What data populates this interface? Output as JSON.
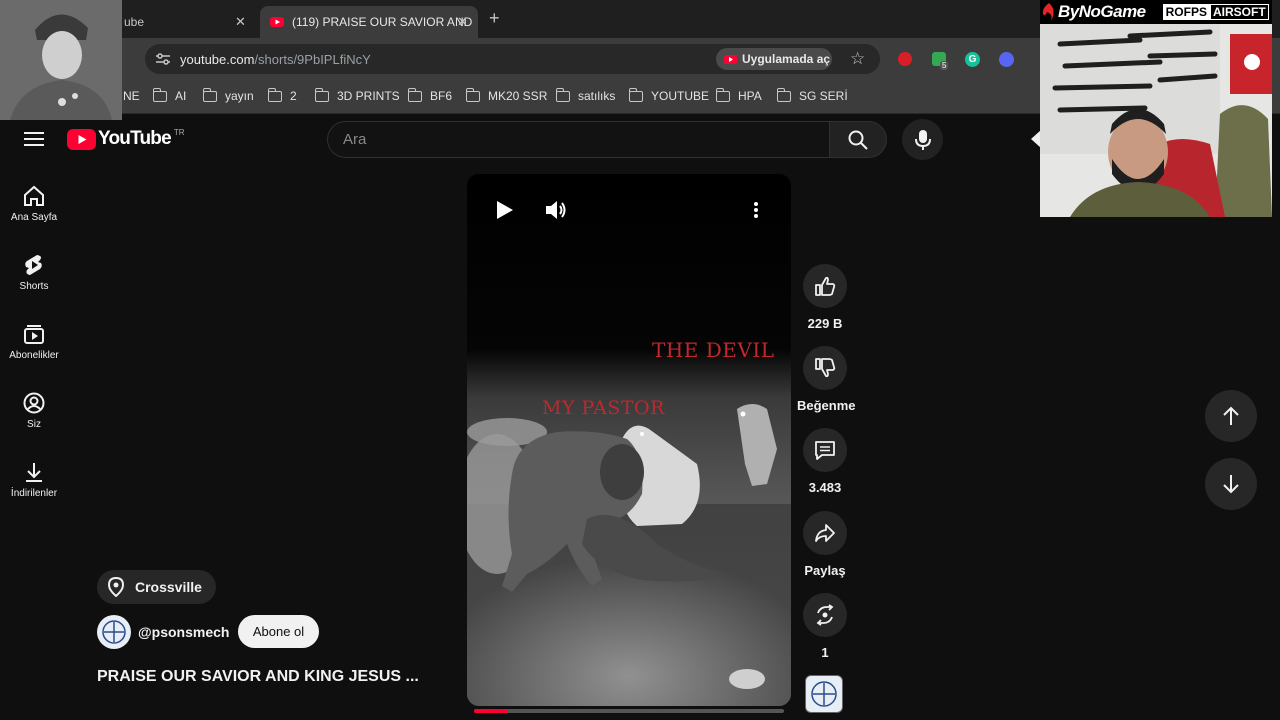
{
  "browser": {
    "tabs": [
      {
        "title": "ube"
      },
      {
        "title": "(119) PRAISE OUR SAVIOR AND"
      }
    ],
    "new_tab_symbol": "+",
    "url_host": "youtube.com",
    "url_path": "/shorts/9PbIPLfiNcY",
    "open_in_app_label": "Uygulamada aç",
    "extension_badge": "5",
    "bookmarks": [
      {
        "label": "NE",
        "folder": false
      },
      {
        "label": "AI",
        "folder": true
      },
      {
        "label": "yayın",
        "folder": true
      },
      {
        "label": "2",
        "folder": true
      },
      {
        "label": "3D PRINTS",
        "folder": true
      },
      {
        "label": "BF6",
        "folder": true
      },
      {
        "label": "MK20 SSR",
        "folder": true
      },
      {
        "label": "satılıks",
        "folder": true
      },
      {
        "label": "YOUTUBE",
        "folder": true
      },
      {
        "label": "HPA",
        "folder": true
      },
      {
        "label": "SG SERİ",
        "folder": true
      }
    ]
  },
  "youtube": {
    "logo_text": "YouTube",
    "region": "TR",
    "search_placeholder": "Ara",
    "sidebar": [
      {
        "label": "Ana Sayfa",
        "icon": "home-icon"
      },
      {
        "label": "Shorts",
        "icon": "shorts-icon"
      },
      {
        "label": "Abonelikler",
        "icon": "subscriptions-icon"
      },
      {
        "label": "Siz",
        "icon": "profile-icon"
      },
      {
        "label": "İndirilenler",
        "icon": "download-icon"
      }
    ],
    "short": {
      "overlay_text_1": "THE DEVIL",
      "overlay_text_2": "MY PASTOR",
      "location": "Crossville",
      "channel": "@psonsmech",
      "subscribe_label": "Abone ol",
      "title": "PRAISE OUR SAVIOR AND KING JESUS ...",
      "progress": 0.11
    },
    "actions": {
      "likes": "229 B",
      "dislike_label": "Beğenme",
      "comments": "3.483",
      "share_label": "Paylaş",
      "remix_count": "1"
    },
    "colors": {
      "accent_red": "#ff0033",
      "overlay_red": "#c0282d"
    }
  },
  "stream_overlay": {
    "brand": "ByNoGame",
    "tag_left": "ROFPS",
    "tag_right": "AIRSOFT"
  }
}
